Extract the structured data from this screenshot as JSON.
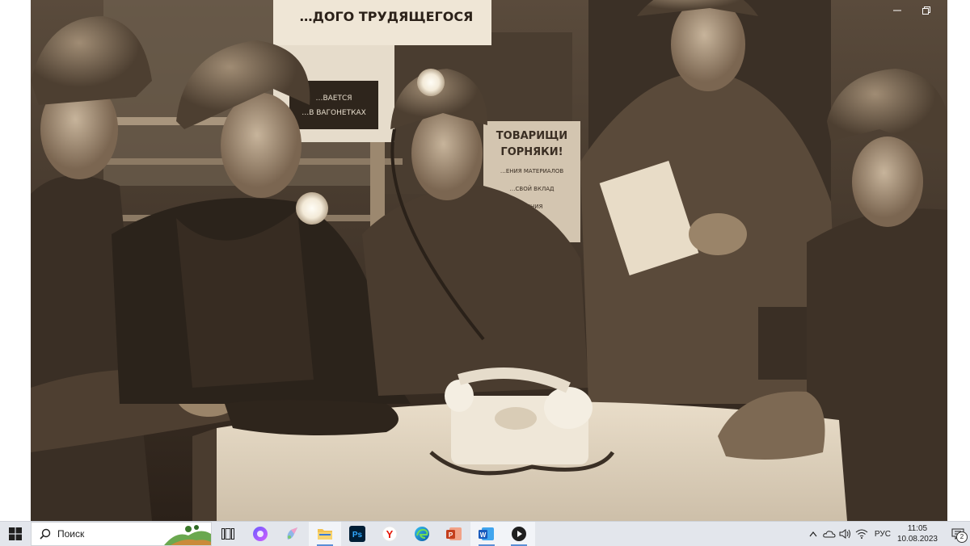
{
  "viewer": {
    "photo": {
      "sign_text": "…ДОГО ТРУДЯЩЕГОСЯ",
      "poster_text": [
        "ТОВАРИЩИ",
        "ГОРНЯКИ!"
      ],
      "poster_small": [
        "…ЕНИЯ МАТЕРИАЛОВ",
        "…СВОЙ ВКЛАД",
        "…ЕНИЯ"
      ],
      "board_text": [
        "…ВАЕТСЯ",
        "…В ВАГОНЕТКАХ"
      ]
    },
    "window_controls": [
      "minimize",
      "maximize",
      "close"
    ]
  },
  "taskbar": {
    "search_placeholder": "Поиск",
    "pinned_apps": [
      {
        "name": "task-view",
        "active": false
      },
      {
        "name": "yandex-alice",
        "active": false
      },
      {
        "name": "paint-3d",
        "active": false
      },
      {
        "name": "file-explorer",
        "active": true
      },
      {
        "name": "photoshop",
        "active": false,
        "label": "Ps"
      },
      {
        "name": "yandex-browser",
        "active": false,
        "label": "Y"
      },
      {
        "name": "edge",
        "active": false
      },
      {
        "name": "powerpoint",
        "active": false
      },
      {
        "name": "word",
        "active": true,
        "label": "W"
      },
      {
        "name": "media-player",
        "active": true
      }
    ],
    "tray": {
      "language": "РУС",
      "time": "11:05",
      "date": "10.08.2023",
      "notification_count": "2"
    }
  },
  "colors": {
    "taskbar_bg": "#e3e6ec",
    "sepia_dark": "#2a2119",
    "sepia_mid": "#7a6a58",
    "sepia_light": "#d8cbb8"
  }
}
